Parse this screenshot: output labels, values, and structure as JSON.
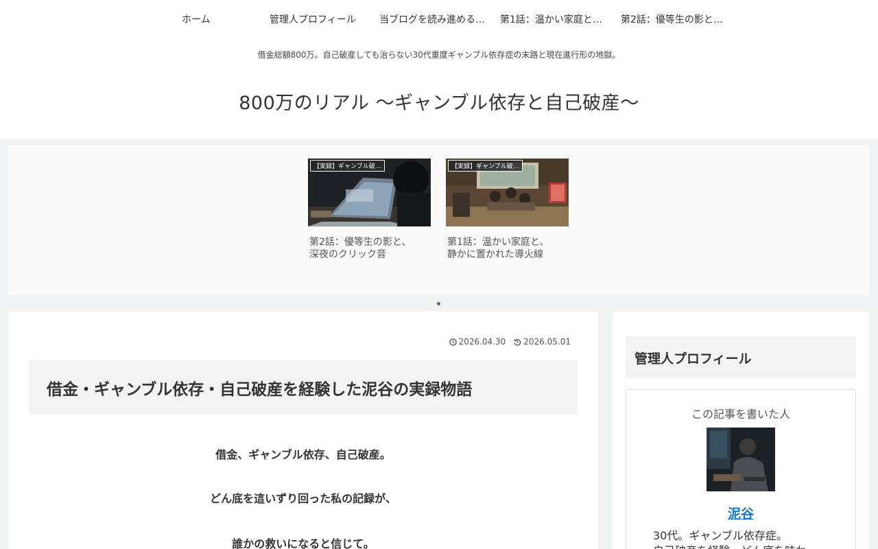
{
  "nav": {
    "items": [
      "ホーム",
      "管理人プロフィール",
      "当ブログを読み進める…",
      "第1話：温かい家庭と…",
      "第2話：優等生の影と…"
    ]
  },
  "header": {
    "tagline": "借金総額800万。自己破産しても治らない30代重度ギャンブル依存症の末路と現在進行形の地獄。",
    "site_title": "800万のリアル 〜ギャンブル依存と自己破産〜"
  },
  "carousel": {
    "cards": [
      {
        "category": "【実録】ギャンブル破…",
        "title_line1": "第2話：優等生の影と、",
        "title_line2": "深夜のクリック音"
      },
      {
        "category": "【実録】ギャンブル破…",
        "title_line1": "第1話：温かい家庭と、",
        "title_line2": "静かに置かれた導火線"
      }
    ]
  },
  "article": {
    "published": "2026.04.30",
    "updated": "2026.05.01",
    "title": "借金・ギャンブル依存・自己破産を経験した泥谷の実録物語",
    "lines": [
      "借金、ギャンブル依存、自己破産。",
      "どん底を這いずり回った私の記録が、",
      "誰かの救いになると信じて。"
    ]
  },
  "sidebar": {
    "widget_title": "管理人プロフィール",
    "author_label": "この記事を書いた人",
    "author_name": "泥谷",
    "author_desc_line1": "30代。ギャンブル依存症。",
    "author_desc_line2": "自己破産を経験。どん底を味わ"
  },
  "colors": {
    "background": "#f2f3f4",
    "link": "#1a73c9"
  }
}
